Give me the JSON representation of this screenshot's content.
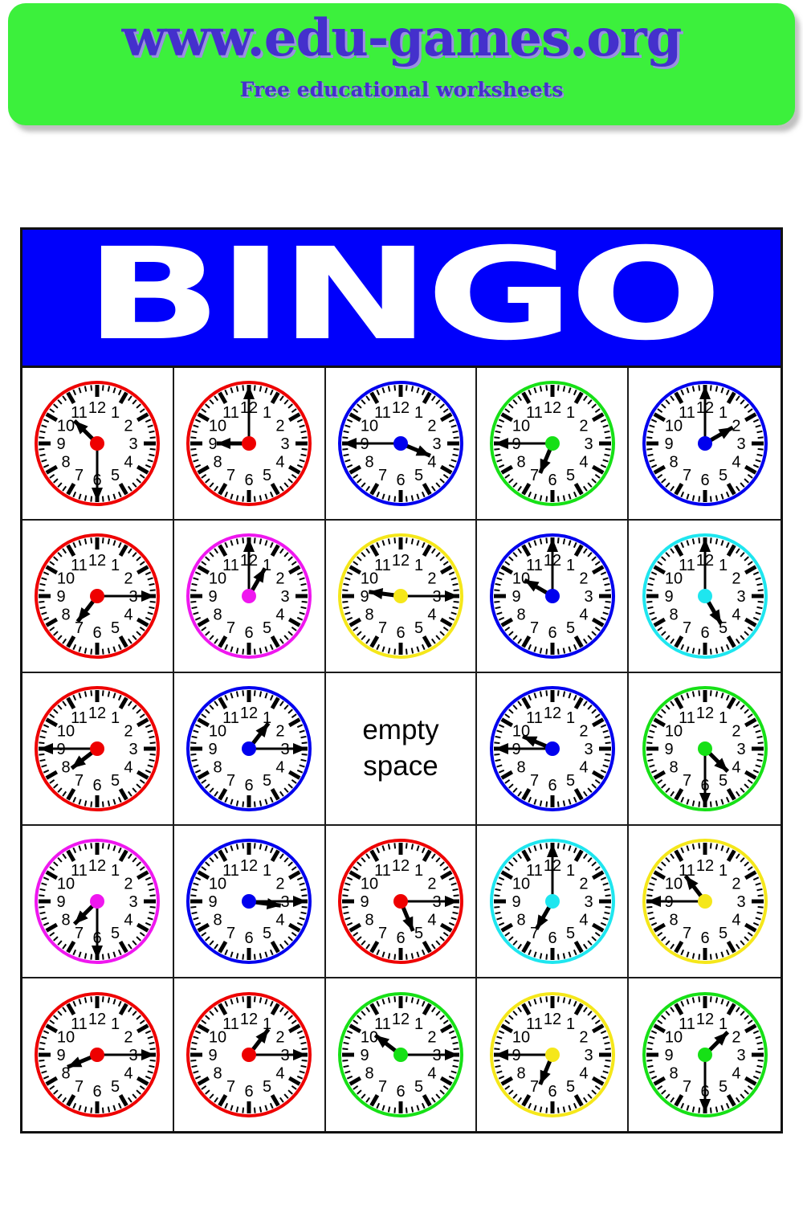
{
  "header": {
    "site_url": "www.edu-games.org",
    "tagline": "Free educational worksheets",
    "banner_color": "#3cf03c",
    "text_color": "#4430cc"
  },
  "card": {
    "title": "BINGO",
    "title_bar_color": "#0000fb",
    "title_text_color": "#ffffff",
    "free_space_label": "empty\nspace",
    "free_space_line1": "empty",
    "free_space_line2": "space",
    "columns": 5,
    "rows": 5
  },
  "chart_data": {
    "type": "table",
    "title": "BINGO",
    "grid": [
      5,
      5
    ],
    "cells": [
      {
        "row": 1,
        "col": 1,
        "kind": "clock",
        "time": "10:30",
        "hour": 10,
        "minute": 30,
        "color": "#ee0000"
      },
      {
        "row": 1,
        "col": 2,
        "kind": "clock",
        "time": "9:00",
        "hour": 9,
        "minute": 0,
        "color": "#ee0000"
      },
      {
        "row": 1,
        "col": 3,
        "kind": "clock",
        "time": "3:45",
        "hour": 3,
        "minute": 45,
        "color": "#0000ee"
      },
      {
        "row": 1,
        "col": 4,
        "kind": "clock",
        "time": "6:45",
        "hour": 6,
        "minute": 45,
        "color": "#16e016"
      },
      {
        "row": 1,
        "col": 5,
        "kind": "clock",
        "time": "2:00",
        "hour": 2,
        "minute": 0,
        "color": "#0000ee"
      },
      {
        "row": 2,
        "col": 1,
        "kind": "clock",
        "time": "7:15",
        "hour": 7,
        "minute": 15,
        "color": "#ee0000"
      },
      {
        "row": 2,
        "col": 2,
        "kind": "clock",
        "time": "1:00",
        "hour": 1,
        "minute": 0,
        "color": "#ef17ef"
      },
      {
        "row": 2,
        "col": 3,
        "kind": "clock",
        "time": "9:15",
        "hour": 9,
        "minute": 15,
        "color": "#f5e71a"
      },
      {
        "row": 2,
        "col": 4,
        "kind": "clock",
        "time": "10:00",
        "hour": 10,
        "minute": 0,
        "color": "#0000ee"
      },
      {
        "row": 2,
        "col": 5,
        "kind": "clock",
        "time": "5:00",
        "hour": 5,
        "minute": 0,
        "color": "#1ee6ef"
      },
      {
        "row": 3,
        "col": 1,
        "kind": "clock",
        "time": "7:45",
        "hour": 7,
        "minute": 45,
        "color": "#ee0000"
      },
      {
        "row": 3,
        "col": 2,
        "kind": "clock",
        "time": "1:15",
        "hour": 1,
        "minute": 15,
        "color": "#0000ee"
      },
      {
        "row": 3,
        "col": 3,
        "kind": "free",
        "time": null,
        "hour": null,
        "minute": null,
        "color": null
      },
      {
        "row": 3,
        "col": 4,
        "kind": "clock",
        "time": "9:45",
        "hour": 9,
        "minute": 45,
        "color": "#0000ee"
      },
      {
        "row": 3,
        "col": 5,
        "kind": "clock",
        "time": "4:30",
        "hour": 4,
        "minute": 30,
        "color": "#16e016"
      },
      {
        "row": 4,
        "col": 1,
        "kind": "clock",
        "time": "7:30",
        "hour": 7,
        "minute": 30,
        "color": "#ef17ef"
      },
      {
        "row": 4,
        "col": 2,
        "kind": "clock",
        "time": "3:15",
        "hour": 3,
        "minute": 15,
        "color": "#0000ee"
      },
      {
        "row": 4,
        "col": 3,
        "kind": "clock",
        "time": "5:15",
        "hour": 5,
        "minute": 15,
        "color": "#ee0000"
      },
      {
        "row": 4,
        "col": 4,
        "kind": "clock",
        "time": "7:00",
        "hour": 7,
        "minute": 0,
        "color": "#1ee6ef"
      },
      {
        "row": 4,
        "col": 5,
        "kind": "clock",
        "time": "10:45",
        "hour": 10,
        "minute": 45,
        "color": "#f5e71a"
      },
      {
        "row": 5,
        "col": 1,
        "kind": "clock",
        "time": "8:15",
        "hour": 8,
        "minute": 15,
        "color": "#ee0000"
      },
      {
        "row": 5,
        "col": 2,
        "kind": "clock",
        "time": "1:15",
        "hour": 1,
        "minute": 15,
        "color": "#ee0000"
      },
      {
        "row": 5,
        "col": 3,
        "kind": "clock",
        "time": "10:15",
        "hour": 10,
        "minute": 15,
        "color": "#16e016"
      },
      {
        "row": 5,
        "col": 4,
        "kind": "clock",
        "time": "6:45",
        "hour": 6,
        "minute": 45,
        "color": "#f5e71a"
      },
      {
        "row": 5,
        "col": 5,
        "kind": "clock",
        "time": "1:30",
        "hour": 1,
        "minute": 30,
        "color": "#16e016"
      }
    ],
    "clock_numerals": [
      "12",
      "1",
      "2",
      "3",
      "4",
      "5",
      "6",
      "7",
      "8",
      "9",
      "10",
      "11"
    ]
  }
}
